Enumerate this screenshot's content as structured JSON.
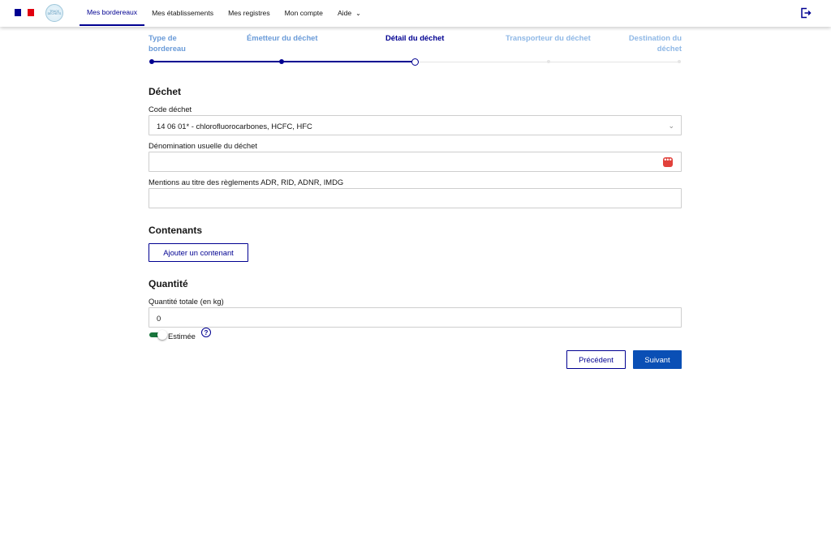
{
  "header": {
    "flag_colors": [
      "#000091",
      "#ffffff",
      "#e1000f"
    ],
    "logo_text": "TRACK DÉCHETS",
    "nav": [
      {
        "label": "Mes bordereaux",
        "active": true
      },
      {
        "label": "Mes établissements",
        "active": false
      },
      {
        "label": "Mes registres",
        "active": false
      },
      {
        "label": "Mon compte",
        "active": false
      },
      {
        "label": "Aide",
        "active": false,
        "dropdown": true
      }
    ],
    "logout_icon": "logout-icon"
  },
  "stepper": {
    "steps": [
      {
        "label_line1": "Type de",
        "label_line2": "bordereau",
        "state": "done"
      },
      {
        "label_line1": "Émetteur du déchet",
        "label_line2": "",
        "state": "done"
      },
      {
        "label_line1": "Détail du déchet",
        "label_line2": "",
        "state": "current"
      },
      {
        "label_line1": "Transporteur du déchet",
        "label_line2": "",
        "state": "todo"
      },
      {
        "label_line1": "Destination du",
        "label_line2": "déchet",
        "state": "todo"
      }
    ]
  },
  "dechet": {
    "title": "Déchet",
    "code_label": "Code déchet",
    "code_value": "14 06 01* - chlorofluorocarbones, HCFC, HFC",
    "denomination_label": "Dénomination usuelle du déchet",
    "denomination_value": "",
    "mentions_label": "Mentions au titre des règlements ADR, RID, ADNR, IMDG",
    "mentions_value": ""
  },
  "contenants": {
    "title": "Contenants",
    "add_button": "Ajouter un contenant"
  },
  "quantite": {
    "title": "Quantité",
    "total_label": "Quantité totale (en kg)",
    "total_value": "0",
    "estimee_label": "Estimée",
    "estimee_on": true,
    "help_glyph": "?"
  },
  "actions": {
    "previous": "Précédent",
    "next": "Suivant"
  },
  "colors": {
    "primary": "#000091",
    "button_blue": "#0a4fb5",
    "toggle_green": "#18753c",
    "step_future": "#8fb8e6"
  }
}
